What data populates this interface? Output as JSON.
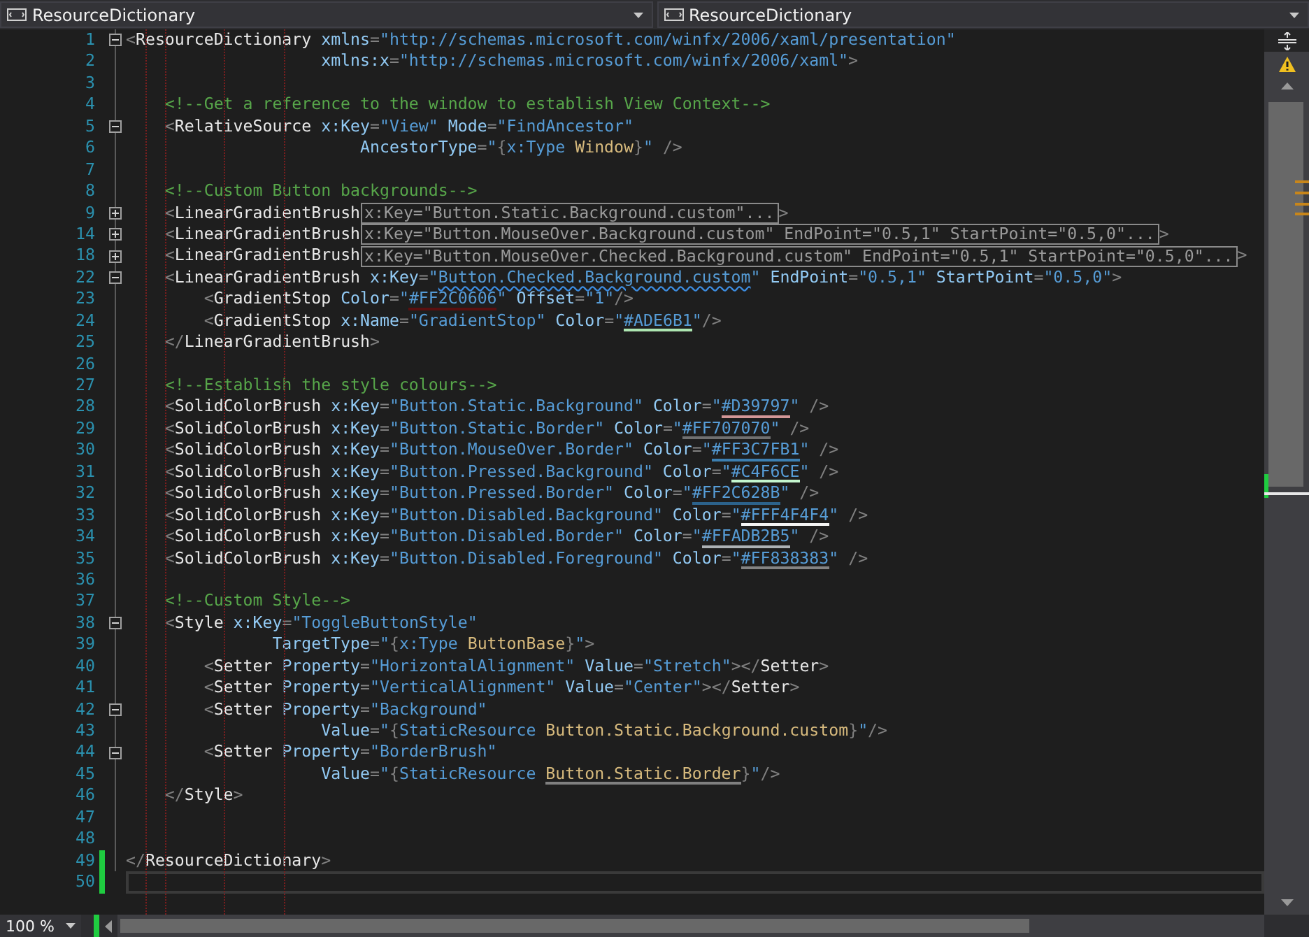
{
  "tabs": [
    {
      "label": "ResourceDictionary"
    },
    {
      "label": "ResourceDictionary"
    }
  ],
  "lines": [
    {
      "n": "1",
      "expanded": true,
      "tokens": [
        {
          "kind": "p",
          "t": "<"
        },
        {
          "kind": "e",
          "t": "ResourceDictionary"
        },
        {
          "kind": "a",
          "t": " xmlns"
        },
        {
          "kind": "p",
          "t": "="
        },
        {
          "kind": "v",
          "t": "\"http://schemas.microsoft.com/winfx/2006/xaml/presentation\""
        }
      ]
    },
    {
      "n": "2",
      "tokens": [
        {
          "kind": "a",
          "t": "                    xmlns:x"
        },
        {
          "kind": "p",
          "t": "="
        },
        {
          "kind": "v",
          "t": "\"http://schemas.microsoft.com/winfx/2006/xaml\""
        },
        {
          "kind": "p",
          "t": ">"
        }
      ]
    },
    {
      "n": "3"
    },
    {
      "n": "4",
      "tokens": [
        {
          "kind": "c",
          "t": "    <!--Get a reference to the window to establish View Context-->"
        }
      ]
    },
    {
      "n": "5",
      "expanded": true,
      "tokens": [
        {
          "kind": "p",
          "t": "    <"
        },
        {
          "kind": "e",
          "t": "RelativeSource"
        },
        {
          "kind": "a",
          "t": " x:Key"
        },
        {
          "kind": "p",
          "t": "="
        },
        {
          "kind": "v",
          "t": "\"View\""
        },
        {
          "kind": "a",
          "t": " Mode"
        },
        {
          "kind": "p",
          "t": "="
        },
        {
          "kind": "v",
          "t": "\"FindAncestor\""
        }
      ]
    },
    {
      "n": "6",
      "tokens": [
        {
          "kind": "a",
          "t": "                        AncestorType"
        },
        {
          "kind": "p",
          "t": "="
        },
        {
          "kind": "v",
          "t": "\""
        },
        {
          "kind": "p",
          "t": "{"
        },
        {
          "kind": "x",
          "t": "x:Type"
        },
        {
          "kind": "r",
          "t": " Window"
        },
        {
          "kind": "p",
          "t": "}"
        },
        {
          "kind": "v",
          "t": "\""
        },
        {
          "kind": "p",
          "t": " />"
        }
      ]
    },
    {
      "n": "7"
    },
    {
      "n": "8",
      "tokens": [
        {
          "kind": "c",
          "t": "    <!--Custom Button backgrounds-->"
        }
      ]
    },
    {
      "n": "9",
      "expanded": false,
      "tokens": [
        {
          "kind": "p",
          "t": "    <"
        },
        {
          "kind": "e",
          "t": "LinearGradientBrush"
        }
      ],
      "hint": "x:Key=\"Button.Static.Background.custom\"...",
      "after": ">"
    },
    {
      "n": "14",
      "expanded": false,
      "tokens": [
        {
          "kind": "p",
          "t": "    <"
        },
        {
          "kind": "e",
          "t": "LinearGradientBrush"
        }
      ],
      "hint": "x:Key=\"Button.MouseOver.Background.custom\" EndPoint=\"0.5,1\" StartPoint=\"0.5,0\"...",
      "after": ">"
    },
    {
      "n": "18",
      "expanded": false,
      "tokens": [
        {
          "kind": "p",
          "t": "    <"
        },
        {
          "kind": "e",
          "t": "LinearGradientBrush"
        }
      ],
      "hint": "x:Key=\"Button.MouseOver.Checked.Background.custom\" EndPoint=\"0.5,1\" StartPoint=\"0.5,0\"...",
      "after": ">"
    },
    {
      "n": "22",
      "expanded": true,
      "tokens": [
        {
          "kind": "p",
          "t": "    <"
        },
        {
          "kind": "e",
          "t": "LinearGradientBrush"
        },
        {
          "kind": "a",
          "t": " x:Key"
        },
        {
          "kind": "p",
          "t": "="
        },
        {
          "kind": "v",
          "t": "\""
        },
        {
          "kind": "v",
          "t": "Button.Checked.Background.custom",
          "squiggle": true
        },
        {
          "kind": "v",
          "t": "\""
        },
        {
          "kind": "a",
          "t": " EndPoint"
        },
        {
          "kind": "p",
          "t": "="
        },
        {
          "kind": "v",
          "t": "\"0.5,1\""
        },
        {
          "kind": "a",
          "t": " StartPoint"
        },
        {
          "kind": "p",
          "t": "="
        },
        {
          "kind": "v",
          "t": "\"0.5,0\""
        },
        {
          "kind": "p",
          "t": ">"
        }
      ]
    },
    {
      "n": "23",
      "tokens": [
        {
          "kind": "p",
          "t": "        <"
        },
        {
          "kind": "e",
          "t": "GradientStop"
        },
        {
          "kind": "a",
          "t": " Color"
        },
        {
          "kind": "p",
          "t": "="
        },
        {
          "kind": "v",
          "t": "\""
        },
        {
          "kind": "v",
          "t": "#FF2C0606",
          "color": "#5a1010"
        },
        {
          "kind": "v",
          "t": "\""
        },
        {
          "kind": "a",
          "t": " Offset"
        },
        {
          "kind": "p",
          "t": "="
        },
        {
          "kind": "v",
          "t": "\"1\""
        },
        {
          "kind": "p",
          "t": "/>"
        }
      ]
    },
    {
      "n": "24",
      "tokens": [
        {
          "kind": "p",
          "t": "        <"
        },
        {
          "kind": "e",
          "t": "GradientStop"
        },
        {
          "kind": "a",
          "t": " x:Name"
        },
        {
          "kind": "p",
          "t": "="
        },
        {
          "kind": "v",
          "t": "\"GradientStop\""
        },
        {
          "kind": "a",
          "t": " Color"
        },
        {
          "kind": "p",
          "t": "="
        },
        {
          "kind": "v",
          "t": "\""
        },
        {
          "kind": "v",
          "t": "#ADE6B1",
          "color": "#ade6b1"
        },
        {
          "kind": "v",
          "t": "\""
        },
        {
          "kind": "p",
          "t": "/>"
        }
      ]
    },
    {
      "n": "25",
      "tokens": [
        {
          "kind": "p",
          "t": "    </"
        },
        {
          "kind": "e",
          "t": "LinearGradientBrush"
        },
        {
          "kind": "p",
          "t": ">"
        }
      ]
    },
    {
      "n": "26"
    },
    {
      "n": "27",
      "tokens": [
        {
          "kind": "c",
          "t": "    <!--Establish the style colours-->"
        }
      ]
    },
    {
      "n": "28",
      "tokens": [
        {
          "kind": "p",
          "t": "    <"
        },
        {
          "kind": "e",
          "t": "SolidColorBrush"
        },
        {
          "kind": "a",
          "t": " x:Key"
        },
        {
          "kind": "p",
          "t": "="
        },
        {
          "kind": "v",
          "t": "\"Button.Static.Background\""
        },
        {
          "kind": "a",
          "t": " Color"
        },
        {
          "kind": "p",
          "t": "="
        },
        {
          "kind": "v",
          "t": "\""
        },
        {
          "kind": "v",
          "t": "#D39797",
          "color": "#d39797"
        },
        {
          "kind": "v",
          "t": "\""
        },
        {
          "kind": "p",
          "t": " />"
        }
      ]
    },
    {
      "n": "29",
      "tokens": [
        {
          "kind": "p",
          "t": "    <"
        },
        {
          "kind": "e",
          "t": "SolidColorBrush"
        },
        {
          "kind": "a",
          "t": " x:Key"
        },
        {
          "kind": "p",
          "t": "="
        },
        {
          "kind": "v",
          "t": "\"Button.Static.Border\""
        },
        {
          "kind": "a",
          "t": " Color"
        },
        {
          "kind": "p",
          "t": "="
        },
        {
          "kind": "v",
          "t": "\""
        },
        {
          "kind": "v",
          "t": "#FF707070",
          "color": "#707070"
        },
        {
          "kind": "v",
          "t": "\""
        },
        {
          "kind": "p",
          "t": " />"
        }
      ]
    },
    {
      "n": "30",
      "tokens": [
        {
          "kind": "p",
          "t": "    <"
        },
        {
          "kind": "e",
          "t": "SolidColorBrush"
        },
        {
          "kind": "a",
          "t": " x:Key"
        },
        {
          "kind": "p",
          "t": "="
        },
        {
          "kind": "v",
          "t": "\"Button.MouseOver.Border\""
        },
        {
          "kind": "a",
          "t": " Color"
        },
        {
          "kind": "p",
          "t": "="
        },
        {
          "kind": "v",
          "t": "\""
        },
        {
          "kind": "v",
          "t": "#FF3C7FB1",
          "color": "#3c7fb1"
        },
        {
          "kind": "v",
          "t": "\""
        },
        {
          "kind": "p",
          "t": " />"
        }
      ]
    },
    {
      "n": "31",
      "tokens": [
        {
          "kind": "p",
          "t": "    <"
        },
        {
          "kind": "e",
          "t": "SolidColorBrush"
        },
        {
          "kind": "a",
          "t": " x:Key"
        },
        {
          "kind": "p",
          "t": "="
        },
        {
          "kind": "v",
          "t": "\"Button.Pressed.Background\""
        },
        {
          "kind": "a",
          "t": " Color"
        },
        {
          "kind": "p",
          "t": "="
        },
        {
          "kind": "v",
          "t": "\""
        },
        {
          "kind": "v",
          "t": "#C4F6CE",
          "color": "#c4f6ce"
        },
        {
          "kind": "v",
          "t": "\""
        },
        {
          "kind": "p",
          "t": " />"
        }
      ]
    },
    {
      "n": "32",
      "tokens": [
        {
          "kind": "p",
          "t": "    <"
        },
        {
          "kind": "e",
          "t": "SolidColorBrush"
        },
        {
          "kind": "a",
          "t": " x:Key"
        },
        {
          "kind": "p",
          "t": "="
        },
        {
          "kind": "v",
          "t": "\"Button.Pressed.Border\""
        },
        {
          "kind": "a",
          "t": " Color"
        },
        {
          "kind": "p",
          "t": "="
        },
        {
          "kind": "v",
          "t": "\""
        },
        {
          "kind": "v",
          "t": "#FF2C628B",
          "color": "#2c628b"
        },
        {
          "kind": "v",
          "t": "\""
        },
        {
          "kind": "p",
          "t": " />"
        }
      ]
    },
    {
      "n": "33",
      "tokens": [
        {
          "kind": "p",
          "t": "    <"
        },
        {
          "kind": "e",
          "t": "SolidColorBrush"
        },
        {
          "kind": "a",
          "t": " x:Key"
        },
        {
          "kind": "p",
          "t": "="
        },
        {
          "kind": "v",
          "t": "\"Button.Disabled.Background\""
        },
        {
          "kind": "a",
          "t": " Color"
        },
        {
          "kind": "p",
          "t": "="
        },
        {
          "kind": "v",
          "t": "\""
        },
        {
          "kind": "v",
          "t": "#FFF4F4F4",
          "color": "#f4f4f4"
        },
        {
          "kind": "v",
          "t": "\""
        },
        {
          "kind": "p",
          "t": " />"
        }
      ]
    },
    {
      "n": "34",
      "tokens": [
        {
          "kind": "p",
          "t": "    <"
        },
        {
          "kind": "e",
          "t": "SolidColorBrush"
        },
        {
          "kind": "a",
          "t": " x:Key"
        },
        {
          "kind": "p",
          "t": "="
        },
        {
          "kind": "v",
          "t": "\"Button.Disabled.Border\""
        },
        {
          "kind": "a",
          "t": " Color"
        },
        {
          "kind": "p",
          "t": "="
        },
        {
          "kind": "v",
          "t": "\""
        },
        {
          "kind": "v",
          "t": "#FFADB2B5",
          "color": "#adb2b5"
        },
        {
          "kind": "v",
          "t": "\""
        },
        {
          "kind": "p",
          "t": " />"
        }
      ]
    },
    {
      "n": "35",
      "tokens": [
        {
          "kind": "p",
          "t": "    <"
        },
        {
          "kind": "e",
          "t": "SolidColorBrush"
        },
        {
          "kind": "a",
          "t": " x:Key"
        },
        {
          "kind": "p",
          "t": "="
        },
        {
          "kind": "v",
          "t": "\"Button.Disabled.Foreground\""
        },
        {
          "kind": "a",
          "t": " Color"
        },
        {
          "kind": "p",
          "t": "="
        },
        {
          "kind": "v",
          "t": "\""
        },
        {
          "kind": "v",
          "t": "#FF838383",
          "color": "#838383"
        },
        {
          "kind": "v",
          "t": "\""
        },
        {
          "kind": "p",
          "t": " />"
        }
      ]
    },
    {
      "n": "36"
    },
    {
      "n": "37",
      "tokens": [
        {
          "kind": "c",
          "t": "    <!--Custom Style-->"
        }
      ]
    },
    {
      "n": "38",
      "expanded": true,
      "tokens": [
        {
          "kind": "p",
          "t": "    <"
        },
        {
          "kind": "e",
          "t": "Style"
        },
        {
          "kind": "a",
          "t": " x:Key"
        },
        {
          "kind": "p",
          "t": "="
        },
        {
          "kind": "v",
          "t": "\"ToggleButtonStyle\""
        }
      ]
    },
    {
      "n": "39",
      "tokens": [
        {
          "kind": "a",
          "t": "               TargetType"
        },
        {
          "kind": "p",
          "t": "="
        },
        {
          "kind": "v",
          "t": "\""
        },
        {
          "kind": "p",
          "t": "{"
        },
        {
          "kind": "x",
          "t": "x:Type"
        },
        {
          "kind": "r",
          "t": " ButtonBase"
        },
        {
          "kind": "p",
          "t": "}"
        },
        {
          "kind": "v",
          "t": "\""
        },
        {
          "kind": "p",
          "t": ">"
        }
      ]
    },
    {
      "n": "40",
      "tokens": [
        {
          "kind": "p",
          "t": "        <"
        },
        {
          "kind": "e",
          "t": "Setter"
        },
        {
          "kind": "a",
          "t": " Property"
        },
        {
          "kind": "p",
          "t": "="
        },
        {
          "kind": "v",
          "t": "\"HorizontalAlignment\""
        },
        {
          "kind": "a",
          "t": " Value"
        },
        {
          "kind": "p",
          "t": "="
        },
        {
          "kind": "v",
          "t": "\"Stretch\""
        },
        {
          "kind": "p",
          "t": "></"
        },
        {
          "kind": "e",
          "t": "Setter"
        },
        {
          "kind": "p",
          "t": ">"
        }
      ]
    },
    {
      "n": "41",
      "tokens": [
        {
          "kind": "p",
          "t": "        <"
        },
        {
          "kind": "e",
          "t": "Setter"
        },
        {
          "kind": "a",
          "t": " Property"
        },
        {
          "kind": "p",
          "t": "="
        },
        {
          "kind": "v",
          "t": "\"VerticalAlignment\""
        },
        {
          "kind": "a",
          "t": " Value"
        },
        {
          "kind": "p",
          "t": "="
        },
        {
          "kind": "v",
          "t": "\"Center\""
        },
        {
          "kind": "p",
          "t": "></"
        },
        {
          "kind": "e",
          "t": "Setter"
        },
        {
          "kind": "p",
          "t": ">"
        }
      ]
    },
    {
      "n": "42",
      "expanded": true,
      "tokens": [
        {
          "kind": "p",
          "t": "        <"
        },
        {
          "kind": "e",
          "t": "Setter"
        },
        {
          "kind": "a",
          "t": " Property"
        },
        {
          "kind": "p",
          "t": "="
        },
        {
          "kind": "v",
          "t": "\"Background\""
        }
      ]
    },
    {
      "n": "43",
      "tokens": [
        {
          "kind": "a",
          "t": "                    Value"
        },
        {
          "kind": "p",
          "t": "="
        },
        {
          "kind": "v",
          "t": "\""
        },
        {
          "kind": "p",
          "t": "{"
        },
        {
          "kind": "x",
          "t": "StaticResource"
        },
        {
          "kind": "r",
          "t": " Button.Static.Background.custom"
        },
        {
          "kind": "p",
          "t": "}"
        },
        {
          "kind": "v",
          "t": "\""
        },
        {
          "kind": "p",
          "t": "/>"
        }
      ]
    },
    {
      "n": "44",
      "expanded": true,
      "tokens": [
        {
          "kind": "p",
          "t": "        <"
        },
        {
          "kind": "e",
          "t": "Setter"
        },
        {
          "kind": "a",
          "t": " Property"
        },
        {
          "kind": "p",
          "t": "="
        },
        {
          "kind": "v",
          "t": "\"BorderBrush\""
        }
      ]
    },
    {
      "n": "45",
      "tokens": [
        {
          "kind": "a",
          "t": "                    Value"
        },
        {
          "kind": "p",
          "t": "="
        },
        {
          "kind": "v",
          "t": "\""
        },
        {
          "kind": "p",
          "t": "{"
        },
        {
          "kind": "x",
          "t": "StaticResource "
        },
        {
          "kind": "r",
          "t": "Button.Static.Border",
          "color": "#808080"
        },
        {
          "kind": "p",
          "t": "}"
        },
        {
          "kind": "v",
          "t": "\""
        },
        {
          "kind": "p",
          "t": "/>"
        }
      ]
    },
    {
      "n": "46",
      "tokens": [
        {
          "kind": "p",
          "t": "    </"
        },
        {
          "kind": "e",
          "t": "Style"
        },
        {
          "kind": "p",
          "t": ">"
        }
      ]
    },
    {
      "n": "47"
    },
    {
      "n": "48"
    },
    {
      "n": "49",
      "changed": true,
      "tokens": [
        {
          "kind": "p",
          "t": "</"
        },
        {
          "kind": "e",
          "t": "ResourceDictionary"
        },
        {
          "kind": "p",
          "t": ">"
        }
      ]
    },
    {
      "n": "50",
      "changed": true,
      "current": true
    }
  ],
  "zoom": "100 %"
}
